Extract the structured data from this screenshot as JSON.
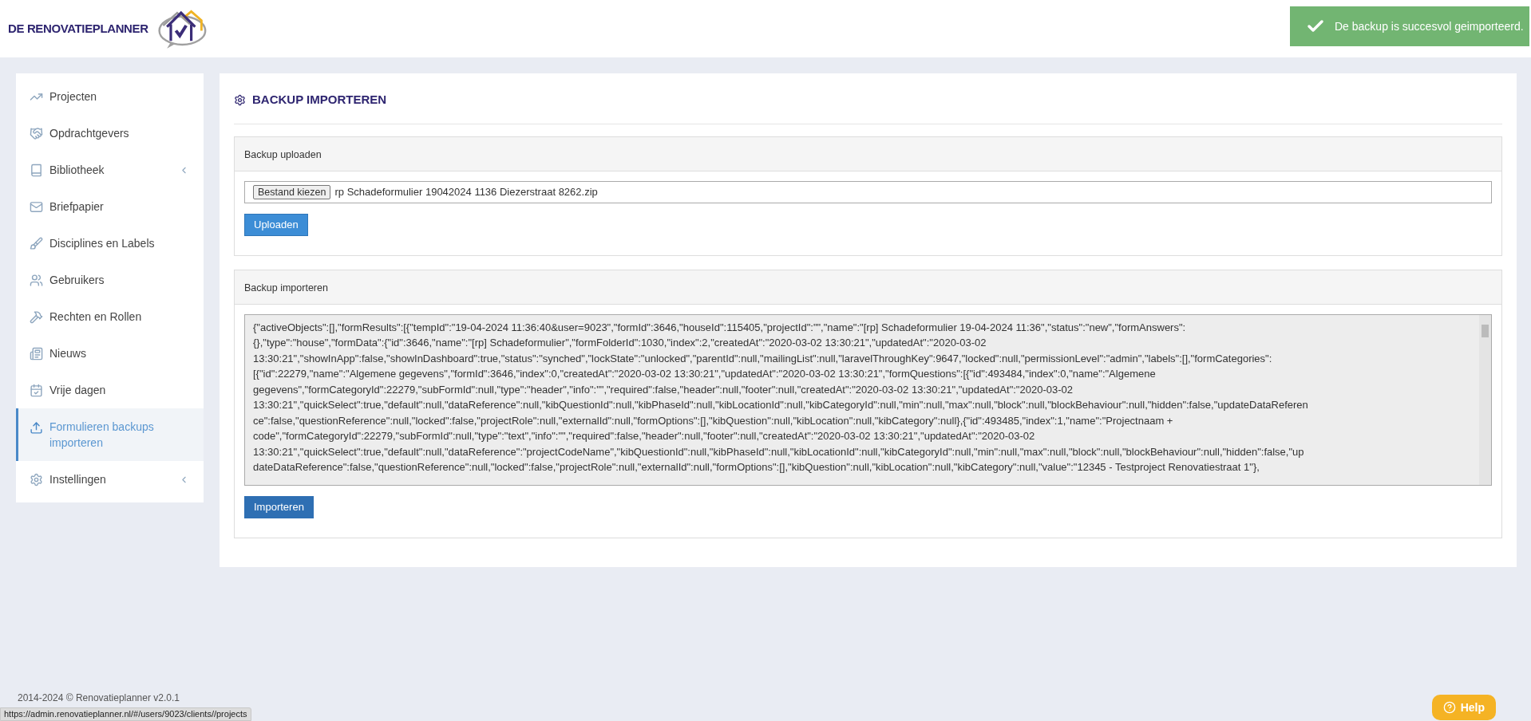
{
  "header": {
    "logo_text": "DE RENOVATIEPLANNER"
  },
  "toast": {
    "message": "De backup is succesvol geimporteerd."
  },
  "sidebar": {
    "items": [
      {
        "label": "Projecten",
        "selected": false,
        "expandable": false
      },
      {
        "label": "Opdrachtgevers",
        "selected": false,
        "expandable": false
      },
      {
        "label": "Bibliotheek",
        "selected": false,
        "expandable": true
      },
      {
        "label": "Briefpapier",
        "selected": false,
        "expandable": false
      },
      {
        "label": "Disciplines en Labels",
        "selected": false,
        "expandable": false
      },
      {
        "label": "Gebruikers",
        "selected": false,
        "expandable": false
      },
      {
        "label": "Rechten en Rollen",
        "selected": false,
        "expandable": false
      },
      {
        "label": "Nieuws",
        "selected": false,
        "expandable": false
      },
      {
        "label": "Vrije dagen",
        "selected": false,
        "expandable": false
      },
      {
        "label": "Formulieren backups importeren",
        "selected": true,
        "expandable": false
      },
      {
        "label": "Instellingen",
        "selected": false,
        "expandable": true
      }
    ]
  },
  "page": {
    "title": "BACKUP IMPORTEREN",
    "upload_panel": {
      "title": "Backup uploaden",
      "file_button": "Bestand kiezen",
      "file_name": "rp Schadeformulier 19042024 1136 Diezerstraat 8262.zip",
      "button": "Uploaden"
    },
    "import_panel": {
      "title": "Backup importeren",
      "content_lines": [
        "{\"activeObjects\":[],\"formResults\":[{\"tempId\":\"19-04-2024 11:36:40&user=9023\",\"formId\":3646,\"houseId\":115405,\"projectId\":\"\",\"name\":\"[rp] Schadeformulier 19-04-2024 11:36\",\"status\":\"new\",\"formAnswers\":",
        "{},\"type\":\"house\",\"formData\":{\"id\":3646,\"name\":\"[rp] Schadeformulier\",\"formFolderId\":1030,\"index\":2,\"createdAt\":\"2020-03-02 13:30:21\",\"updatedAt\":\"2020-03-02",
        "13:30:21\",\"showInApp\":false,\"showInDashboard\":true,\"status\":\"synched\",\"lockState\":\"unlocked\",\"parentId\":null,\"mailingList\":null,\"laravelThroughKey\":9647,\"locked\":null,\"permissionLevel\":\"admin\",\"labels\":[],\"formCategories\":",
        "[{\"id\":22279,\"name\":\"Algemene gegevens\",\"formId\":3646,\"index\":0,\"createdAt\":\"2020-03-02 13:30:21\",\"updatedAt\":\"2020-03-02 13:30:21\",\"formQuestions\":[{\"id\":493484,\"index\":0,\"name\":\"Algemene",
        "gegevens\",\"formCategoryId\":22279,\"subFormId\":null,\"type\":\"header\",\"info\":\"\",\"required\":false,\"header\":null,\"footer\":null,\"createdAt\":\"2020-03-02 13:30:21\",\"updatedAt\":\"2020-03-02",
        "13:30:21\",\"quickSelect\":true,\"default\":null,\"dataReference\":null,\"kibQuestionId\":null,\"kibPhaseId\":null,\"kibLocationId\":null,\"kibCategoryId\":null,\"min\":null,\"max\":null,\"block\":null,\"blockBehaviour\":null,\"hidden\":false,\"updateDataReferen",
        "ce\":false,\"questionReference\":null,\"locked\":false,\"projectRole\":null,\"externalId\":null,\"formOptions\":[],\"kibQuestion\":null,\"kibLocation\":null,\"kibCategory\":null},{\"id\":493485,\"index\":1,\"name\":\"Projectnaam +",
        "code\",\"formCategoryId\":22279,\"subFormId\":null,\"type\":\"text\",\"info\":\"\",\"required\":false,\"header\":null,\"footer\":null,\"createdAt\":\"2020-03-02 13:30:21\",\"updatedAt\":\"2020-03-02",
        "13:30:21\",\"quickSelect\":true,\"default\":null,\"dataReference\":\"projectCodeName\",\"kibQuestionId\":null,\"kibPhaseId\":null,\"kibLocationId\":null,\"kibCategoryId\":null,\"min\":null,\"max\":null,\"block\":null,\"blockBehaviour\":null,\"hidden\":false,\"up",
        "dateDataReference\":false,\"questionReference\":null,\"locked\":false,\"projectRole\":null,\"externalId\":null,\"formOptions\":[],\"kibQuestion\":null,\"kibLocation\":null,\"kibCategory\":null,\"value\":\"12345 - Testproject Renovatiestraat 1\"},"
      ],
      "button": "Importeren"
    }
  },
  "footer": {
    "copyright": "2014-2024 © Renovatieplanner v2.0.1"
  },
  "status_bar": {
    "url": "https://admin.renovatieplanner.nl/#/users/9023/clients//projects"
  },
  "help_button": {
    "label": "Help"
  }
}
